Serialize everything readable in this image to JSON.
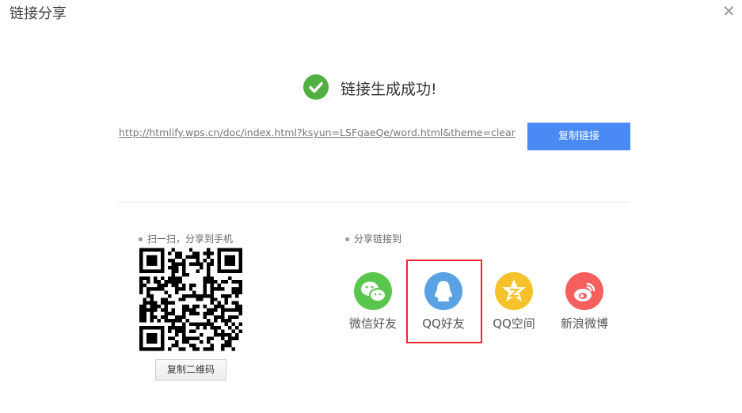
{
  "dialog": {
    "title": "链接分享",
    "close_icon": "close-icon"
  },
  "status": {
    "message": "链接生成成功!",
    "icon": "check-circle-icon",
    "color": "#52b043"
  },
  "link": {
    "url": "http://htmlify.wps.cn/doc/index.html?ksyun=LSFgaeQe/word.html&theme=clear",
    "copy_label": "复制链接",
    "button_color": "#4a8af4"
  },
  "qr": {
    "caption": "扫一扫，分享到手机",
    "copy_label": "复制二维码"
  },
  "share": {
    "caption": "分享链接到",
    "targets": [
      {
        "label": "微信好友",
        "icon": "wechat-icon",
        "color": "#5ac64e"
      },
      {
        "label": "QQ好友",
        "icon": "qq-icon",
        "color": "#5aa2e4"
      },
      {
        "label": "QQ空间",
        "icon": "qzone-icon",
        "color": "#f5c22b"
      },
      {
        "label": "新浪微博",
        "icon": "weibo-icon",
        "color": "#f5605f"
      }
    ]
  }
}
